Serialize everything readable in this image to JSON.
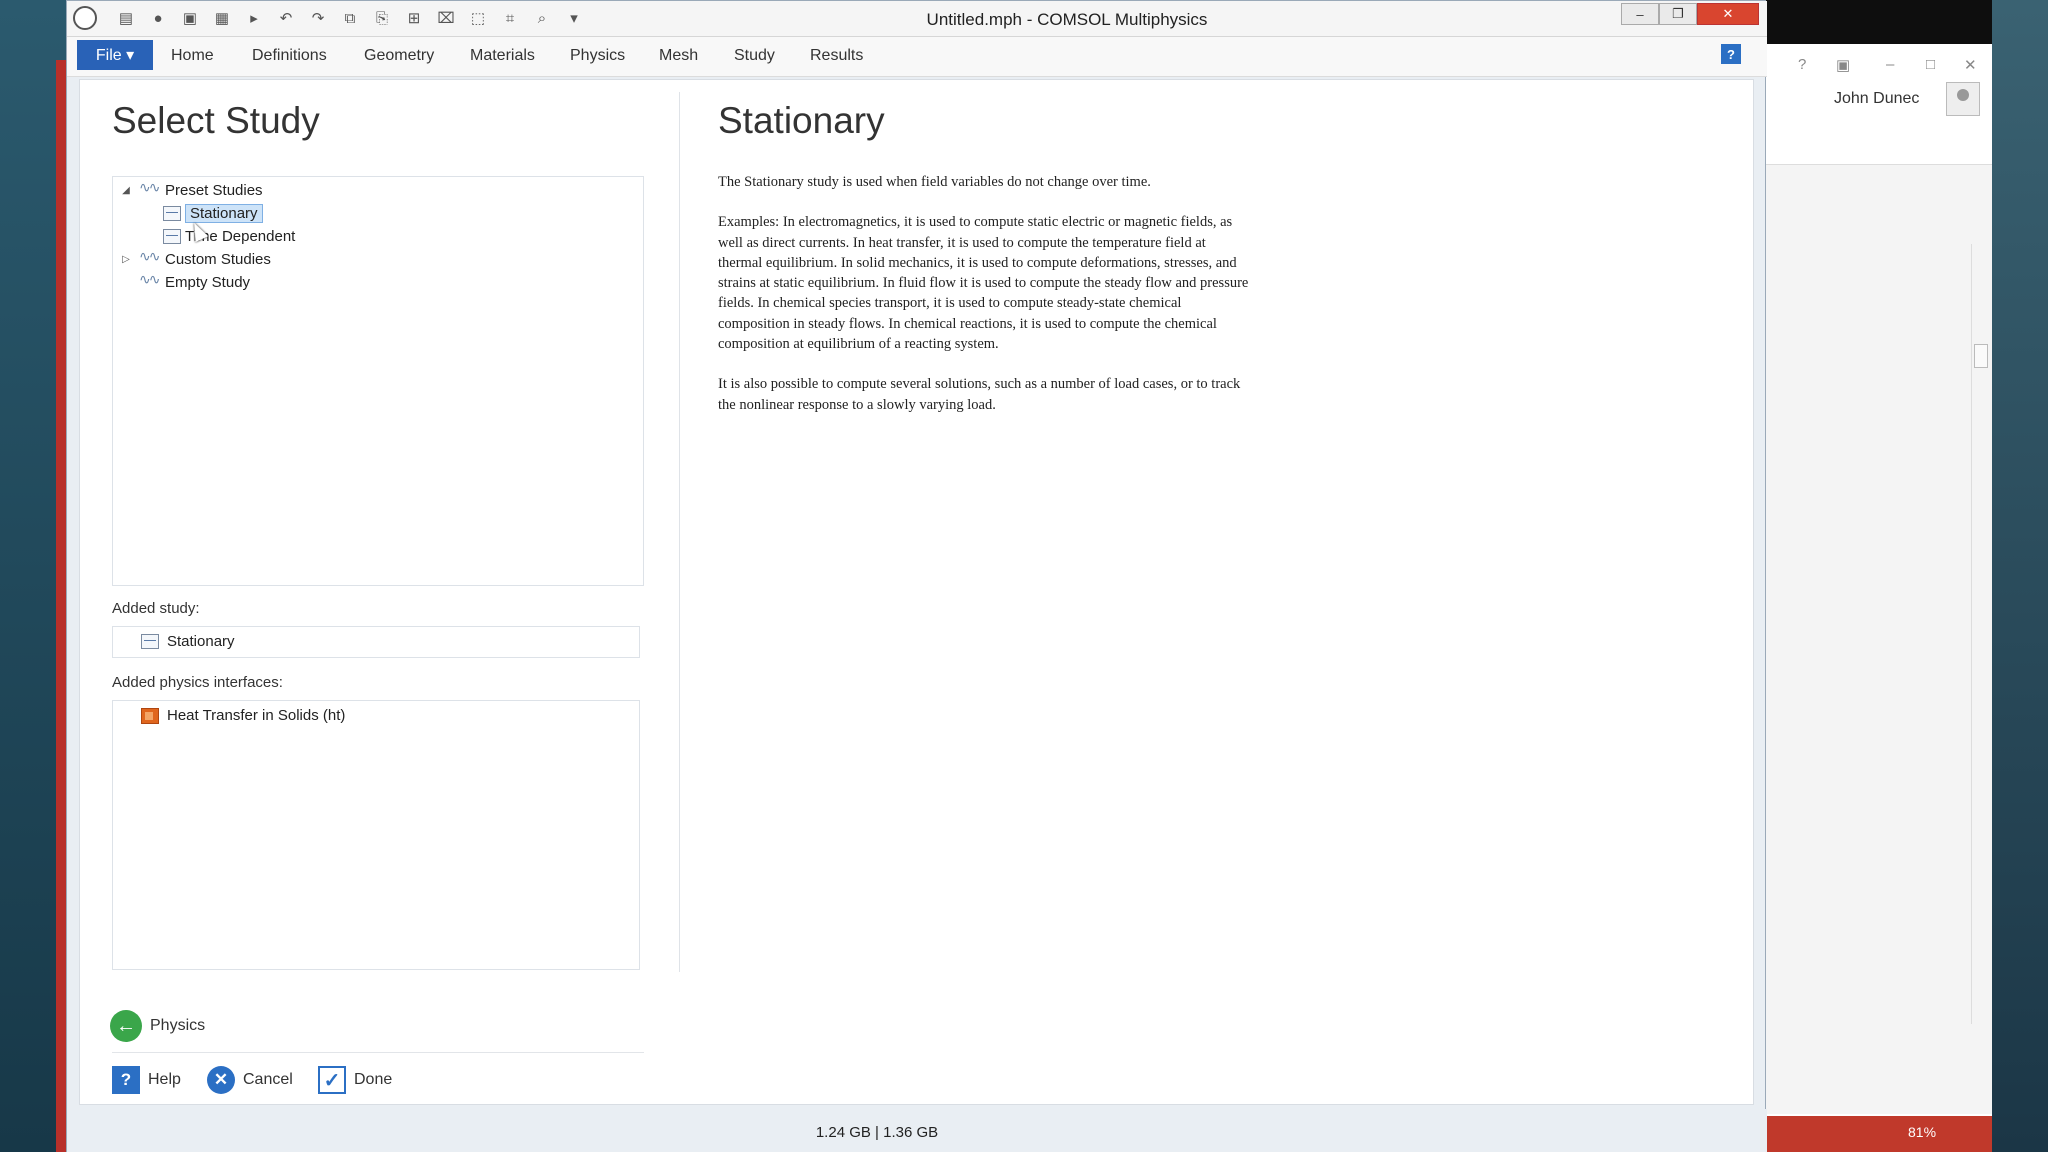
{
  "window": {
    "title": "Untitled.mph - COMSOL Multiphysics"
  },
  "menu": {
    "file": "File ▾",
    "items": [
      "Home",
      "Definitions",
      "Geometry",
      "Materials",
      "Physics",
      "Mesh",
      "Study",
      "Results"
    ]
  },
  "select_study": {
    "heading": "Select Study",
    "tree": {
      "preset": "Preset Studies",
      "stationary": "Stationary",
      "time_dependent": "Time Dependent",
      "custom": "Custom Studies",
      "empty": "Empty Study"
    },
    "added_study_label": "Added study:",
    "added_study": "Stationary",
    "added_physics_label": "Added physics interfaces:",
    "added_physics": "Heat Transfer in Solids (ht)"
  },
  "detail": {
    "heading": "Stationary",
    "paragraphs": [
      "The Stationary study is used when field variables do not change over time.",
      "Examples: In electromagnetics, it is used to compute static electric or magnetic fields, as well as direct currents. In heat transfer, it is used to compute the temperature field at thermal equilibrium. In solid mechanics, it is used to compute deformations, stresses, and strains at static equilibrium. In fluid flow it is used to compute the steady flow and pressure fields. In chemical species transport, it is used to compute steady-state chemical composition in steady flows. In chemical reactions, it is used to compute the chemical composition at equilibrium of a reacting system.",
      "It is also possible to compute several solutions, such as a number of load cases, or to track the nonlinear response to a slowly varying load."
    ]
  },
  "buttons": {
    "back": "Physics",
    "help": "Help",
    "cancel": "Cancel",
    "done": "Done"
  },
  "status": {
    "memory": "1.24 GB | 1.36 GB"
  },
  "bg_window": {
    "user": "John Dunec",
    "zoom": "81%"
  },
  "colors": {
    "accent": "#2962b7",
    "selection": "#cde3f8",
    "close": "#d9452f"
  }
}
